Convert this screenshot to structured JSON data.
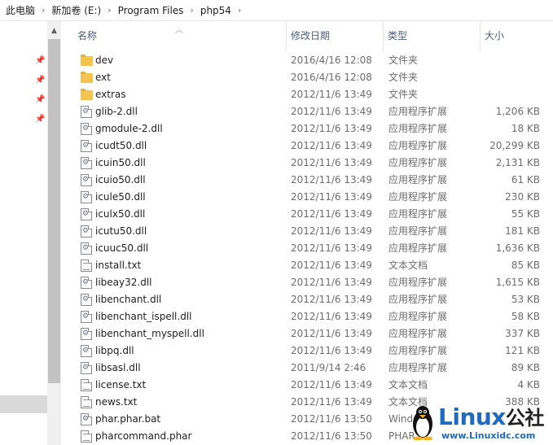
{
  "breadcrumb": [
    "此电脑",
    "新加卷 (E:)",
    "Program Files",
    "php54"
  ],
  "columns": {
    "name": "名称",
    "date": "修改日期",
    "type": "类型",
    "size": "大小"
  },
  "files": [
    {
      "name": "dev",
      "date": "2016/4/16 12:08",
      "type": "文件夹",
      "size": "",
      "icon": "folder-icon"
    },
    {
      "name": "ext",
      "date": "2016/4/16 12:08",
      "type": "文件夹",
      "size": "",
      "icon": "folder-icon"
    },
    {
      "name": "extras",
      "date": "2012/11/6 13:49",
      "type": "文件夹",
      "size": "",
      "icon": "folder-icon"
    },
    {
      "name": "glib-2.dll",
      "date": "2012/11/6 13:49",
      "type": "应用程序扩展",
      "size": "1,206 KB",
      "icon": "dll-icon"
    },
    {
      "name": "gmodule-2.dll",
      "date": "2012/11/6 13:49",
      "type": "应用程序扩展",
      "size": "18 KB",
      "icon": "dll-icon"
    },
    {
      "name": "icudt50.dll",
      "date": "2012/11/6 13:49",
      "type": "应用程序扩展",
      "size": "20,299 KB",
      "icon": "dll-icon"
    },
    {
      "name": "icuin50.dll",
      "date": "2012/11/6 13:49",
      "type": "应用程序扩展",
      "size": "2,131 KB",
      "icon": "dll-icon"
    },
    {
      "name": "icuio50.dll",
      "date": "2012/11/6 13:49",
      "type": "应用程序扩展",
      "size": "61 KB",
      "icon": "dll-icon"
    },
    {
      "name": "icule50.dll",
      "date": "2012/11/6 13:49",
      "type": "应用程序扩展",
      "size": "230 KB",
      "icon": "dll-icon"
    },
    {
      "name": "iculx50.dll",
      "date": "2012/11/6 13:49",
      "type": "应用程序扩展",
      "size": "55 KB",
      "icon": "dll-icon"
    },
    {
      "name": "icutu50.dll",
      "date": "2012/11/6 13:49",
      "type": "应用程序扩展",
      "size": "181 KB",
      "icon": "dll-icon"
    },
    {
      "name": "icuuc50.dll",
      "date": "2012/11/6 13:49",
      "type": "应用程序扩展",
      "size": "1,636 KB",
      "icon": "dll-icon"
    },
    {
      "name": "install.txt",
      "date": "2012/11/6 13:49",
      "type": "文本文档",
      "size": "85 KB",
      "icon": "txt-icon"
    },
    {
      "name": "libeay32.dll",
      "date": "2012/11/6 13:49",
      "type": "应用程序扩展",
      "size": "1,615 KB",
      "icon": "dll-icon"
    },
    {
      "name": "libenchant.dll",
      "date": "2012/11/6 13:49",
      "type": "应用程序扩展",
      "size": "53 KB",
      "icon": "dll-icon"
    },
    {
      "name": "libenchant_ispell.dll",
      "date": "2012/11/6 13:49",
      "type": "应用程序扩展",
      "size": "58 KB",
      "icon": "dll-icon"
    },
    {
      "name": "libenchant_myspell.dll",
      "date": "2012/11/6 13:49",
      "type": "应用程序扩展",
      "size": "337 KB",
      "icon": "dll-icon"
    },
    {
      "name": "libpq.dll",
      "date": "2012/11/6 13:49",
      "type": "应用程序扩展",
      "size": "121 KB",
      "icon": "dll-icon"
    },
    {
      "name": "libsasl.dll",
      "date": "2011/9/14 2:46",
      "type": "应用程序扩展",
      "size": "89 KB",
      "icon": "dll-icon"
    },
    {
      "name": "license.txt",
      "date": "2012/11/6 13:49",
      "type": "文本文档",
      "size": "4 KB",
      "icon": "txt-icon"
    },
    {
      "name": "news.txt",
      "date": "2012/11/6 13:49",
      "type": "文本文档",
      "size": "388 KB",
      "icon": "txt-icon"
    },
    {
      "name": "phar.phar.bat",
      "date": "2012/11/6 13:50",
      "type": "Wind",
      "size": "",
      "icon": "bat-icon"
    },
    {
      "name": "pharcommand.phar",
      "date": "2012/11/6 13:50",
      "type": "PHAR",
      "size": "",
      "icon": "txt-icon"
    }
  ],
  "watermark": {
    "logo": "Linux",
    "logo_suffix": "公社",
    "url": "www.Linuxidc.com"
  },
  "colors": {
    "header_text": "#4c607a",
    "folder": "#f3c54f",
    "watermark": "#1f6bc2"
  }
}
